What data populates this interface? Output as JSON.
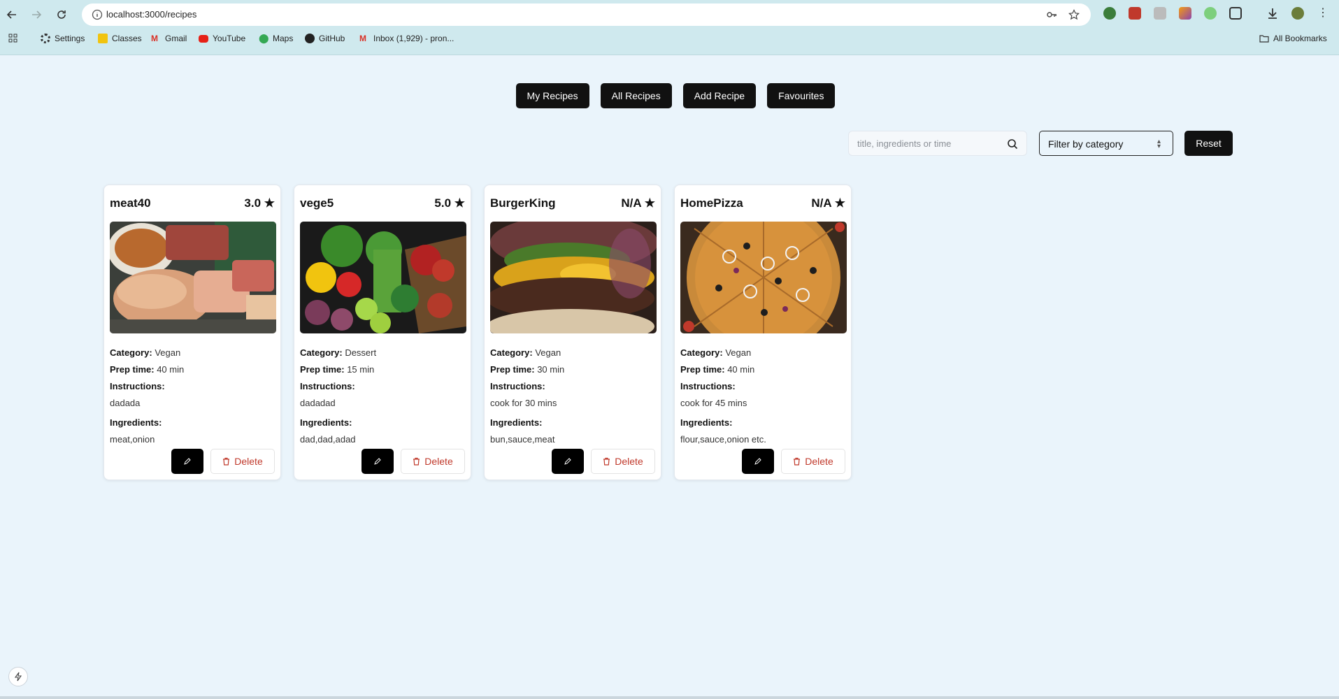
{
  "browser": {
    "url": "localhost:3000/recipes",
    "bookmarks": [
      {
        "icon": "settings-gear-icon",
        "label": "Settings"
      },
      {
        "icon": "classes-icon",
        "label": "Classes"
      },
      {
        "icon": "gmail-icon",
        "label": "Gmail"
      },
      {
        "icon": "youtube-icon",
        "label": "YouTube"
      },
      {
        "icon": "maps-icon",
        "label": "Maps"
      },
      {
        "icon": "github-icon",
        "label": "GitHub"
      },
      {
        "icon": "gmail-icon",
        "label": "Inbox (1,929) - pron..."
      }
    ],
    "all_bookmarks": "All Bookmarks"
  },
  "nav": {
    "my_recipes": "My Recipes",
    "all_recipes": "All Recipes",
    "add_recipe": "Add Recipe",
    "favourites": "Favourites"
  },
  "toolbar": {
    "search_placeholder": "title, ingredients or time",
    "filter_label": "Filter by category",
    "reset_label": "Reset"
  },
  "labels": {
    "category": "Category:",
    "prep_time": "Prep time:",
    "instructions": "Instructions:",
    "ingredients": "Ingredients:",
    "delete": "Delete"
  },
  "recipes": [
    {
      "title": "meat40",
      "rating": "3.0 ★",
      "category": "Vegan",
      "prep_time": "40 min",
      "instructions": "dadada",
      "ingredients": "meat,onion",
      "image": "meat-platter"
    },
    {
      "title": "vege5",
      "rating": "5.0 ★",
      "category": "Dessert",
      "prep_time": "15 min",
      "instructions": "dadadad",
      "ingredients": "dad,dad,adad",
      "image": "vegetable-crate"
    },
    {
      "title": "BurgerKing",
      "rating": "N/A ★",
      "category": "Vegan",
      "prep_time": "30 min",
      "instructions": "cook for 30 mins",
      "ingredients": "bun,sauce,meat",
      "image": "burger-closeup"
    },
    {
      "title": "HomePizza",
      "rating": "N/A ★",
      "category": "Vegan",
      "prep_time": "40 min",
      "instructions": "cook for 45 mins",
      "ingredients": "flour,sauce,onion etc.",
      "image": "pizza-top-view"
    }
  ]
}
